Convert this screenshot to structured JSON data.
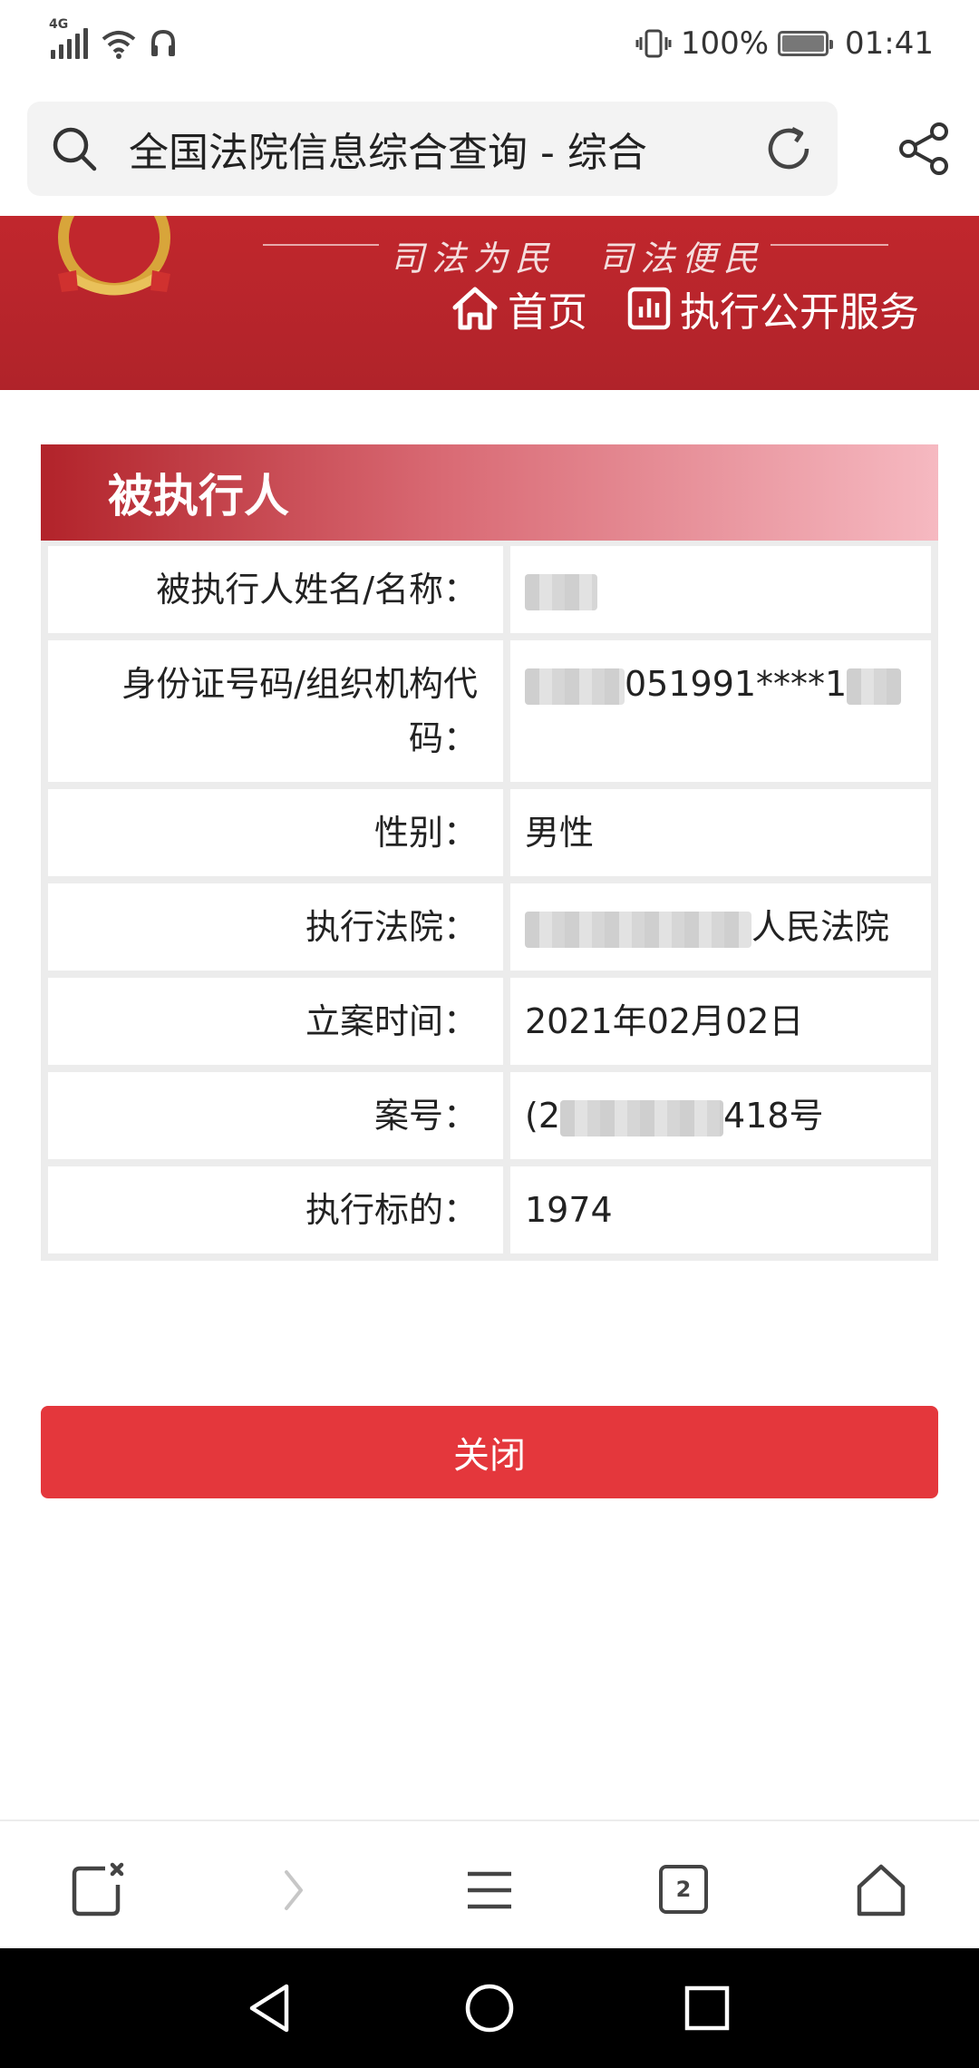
{
  "status_bar": {
    "network": "4G",
    "battery": "100%",
    "time": "01:41",
    "battery_level": 1.0
  },
  "browser": {
    "page_title": "全国法院信息综合查询 - 综合",
    "icons": [
      "search-icon",
      "refresh-icon",
      "share-icon"
    ]
  },
  "site_header": {
    "slogan": "司法为民　司法便民",
    "nav": {
      "home": "首页",
      "enforcement": "执行公开服务"
    },
    "colors": {
      "banner": "#b72529"
    }
  },
  "card": {
    "title": "被执行人",
    "rows": [
      {
        "label": "被执行人姓名/名称：",
        "value": ""
      },
      {
        "label": "身份证号码/组织机构代码：",
        "value": "051991****1"
      },
      {
        "label": "性别：",
        "value": "男性"
      },
      {
        "label": "执行法院：",
        "value": "人民法院"
      },
      {
        "label": "立案时间：",
        "value": "2021年02月02日"
      },
      {
        "label": "案号：",
        "value": "(2",
        "value_tail": "418号"
      },
      {
        "label": "执行标的：",
        "value": "1974"
      }
    ]
  },
  "actions": {
    "close": "关闭",
    "close_color": "#e4373c"
  },
  "toolbar": {
    "tab_count": "2"
  }
}
